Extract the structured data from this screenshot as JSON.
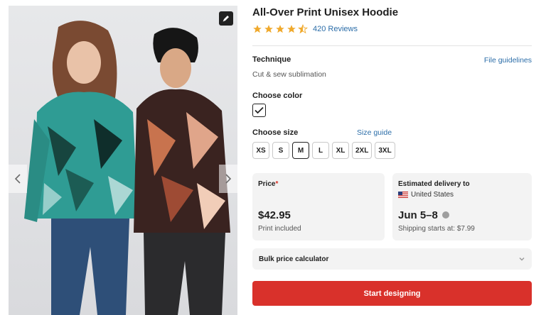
{
  "product": {
    "title": "All-Over Print Unisex Hoodie",
    "rating": 4.5,
    "reviews_label": "420 Reviews"
  },
  "technique": {
    "label": "Technique",
    "value": "Cut & sew sublimation",
    "guidelines_link": "File guidelines"
  },
  "color": {
    "label": "Choose color",
    "selected": "checked"
  },
  "size": {
    "label": "Choose size",
    "guide_link": "Size guide",
    "options": [
      "XS",
      "S",
      "M",
      "L",
      "XL",
      "2XL",
      "3XL"
    ],
    "selected": "M"
  },
  "price": {
    "label": "Price",
    "required_mark": "*",
    "amount": "$42.95",
    "note": "Print included"
  },
  "delivery": {
    "label": "Estimated delivery to",
    "country": "United States",
    "dates": "Jun 5–8",
    "shipping": "Shipping starts at: $7.99"
  },
  "bulk": {
    "label": "Bulk price calculator"
  },
  "cta": {
    "label": "Start designing"
  },
  "colors": {
    "star": "#f0a92c",
    "link": "#2b6da8",
    "cta": "#d9312b"
  }
}
